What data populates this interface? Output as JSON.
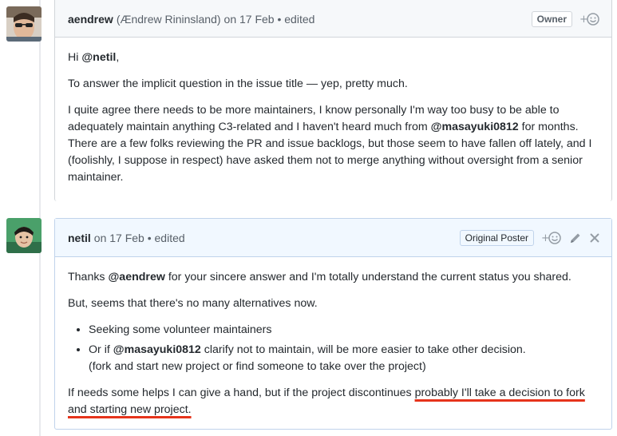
{
  "comments": [
    {
      "author": "aendrew",
      "author_fullname": "(Ændrew Rininsland)",
      "meta": "on 17 Feb • edited",
      "badge": "Owner",
      "avatar_color": "#c9b8a6",
      "icons": [
        "add-reaction-icon"
      ],
      "body": {
        "greeting_prefix": "Hi ",
        "greeting_mention": "@netil",
        "greeting_suffix": ",",
        "p1": "To answer the implicit question in the issue title — yep, pretty much.",
        "p2_part1": "I quite agree there needs to be more maintainers, I know personally I'm way too busy to be able to adequately maintain anything C3-related and I haven't heard much from ",
        "p2_mention": "@masayuki0812",
        "p2_part2": " for months. There are a few folks reviewing the PR and issue backlogs, but those seem to have fallen off lately, and I (foolishly, I suppose in respect) have asked them not to merge anything without oversight from a senior maintainer."
      }
    },
    {
      "author": "netil",
      "meta": "on 17 Feb • edited",
      "badge": "Original Poster",
      "avatar_color": "#3a8f5c",
      "icons": [
        "add-reaction-icon",
        "pencil-icon",
        "close-icon"
      ],
      "body": {
        "p1_prefix": "Thanks ",
        "p1_mention": "@aendrew",
        "p1_suffix": " for your sincere answer and I'm totally understand the current status you shared.",
        "p2": "But, seems that there's no many alternatives now.",
        "li1": "Seeking some volunteer maintainers",
        "li2_prefix": "Or if ",
        "li2_mention": "@masayuki0812",
        "li2_suffix": " clarify not to maintain, will be more easier to take other decision.",
        "li2_line2": "(fork and start new project or find someone to take over the project)",
        "p3_plain": "If needs some helps I can give a hand, but if the project discontinues ",
        "p3_underlined": "probably I'll take a decision to fork and starting new project."
      }
    }
  ],
  "colors": {
    "underline": "#e6331b",
    "header_highlight": "#f1f8ff"
  }
}
